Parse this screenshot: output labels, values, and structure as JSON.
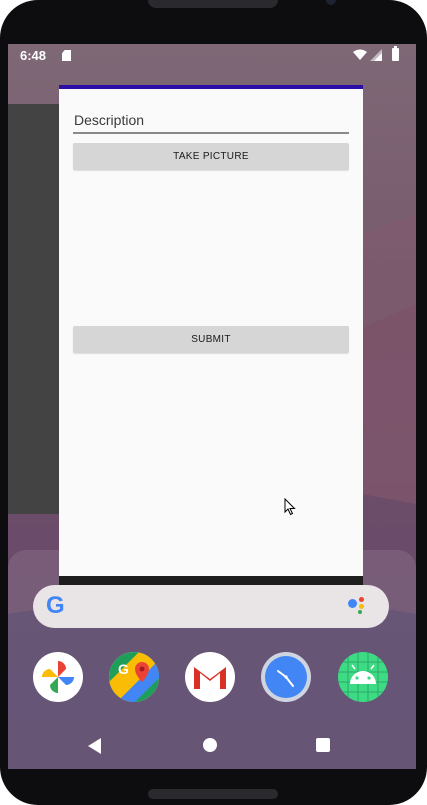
{
  "status_bar": {
    "time": "6:48",
    "icons": [
      "sd-card-icon",
      "wifi-icon",
      "signal-icon",
      "battery-icon"
    ]
  },
  "app": {
    "accent_color": "#2c0da8",
    "description_field": {
      "value": "",
      "placeholder": "Description"
    },
    "take_picture_label": "TAKE PICTURE",
    "submit_label": "SUBMIT"
  },
  "search_bar": {
    "logo": "G",
    "icons": [
      "google-logo-icon",
      "assistant-icon"
    ]
  },
  "dock": {
    "apps": [
      {
        "name": "Photos",
        "icon": "photos-icon"
      },
      {
        "name": "Maps",
        "icon": "maps-icon"
      },
      {
        "name": "Gmail",
        "icon": "gmail-icon"
      },
      {
        "name": "Clock",
        "icon": "clock-icon"
      },
      {
        "name": "Android",
        "icon": "android-icon"
      }
    ]
  },
  "nav_bar": {
    "buttons": [
      "back-icon",
      "home-icon",
      "recents-icon"
    ]
  }
}
